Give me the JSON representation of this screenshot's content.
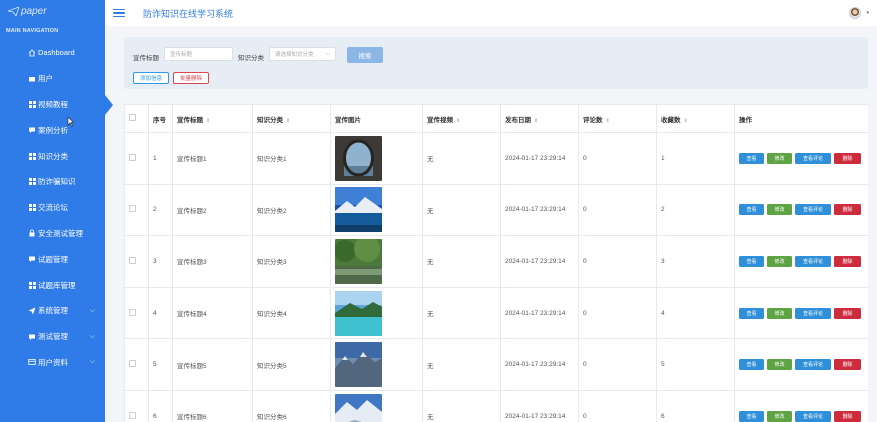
{
  "sidebar": {
    "logo": "paper",
    "nav_header": "MAIN NAVIGATION",
    "items": [
      {
        "label": "Dashboard",
        "icon": "home-icon"
      },
      {
        "label": "用户",
        "icon": "user-icon"
      },
      {
        "label": "视频教程",
        "icon": "grid-icon",
        "active": true
      },
      {
        "label": "案例分析",
        "icon": "comment-icon"
      },
      {
        "label": "知识分类",
        "icon": "grid-icon"
      },
      {
        "label": "防诈骗知识",
        "icon": "grid-icon"
      },
      {
        "label": "交流论坛",
        "icon": "grid-icon"
      },
      {
        "label": "安全测试管理",
        "icon": "lock-icon"
      },
      {
        "label": "试题管理",
        "icon": "comment-icon"
      },
      {
        "label": "试题库管理",
        "icon": "grid-icon"
      },
      {
        "label": "系统管理",
        "icon": "send-icon",
        "expandable": true
      },
      {
        "label": "测试管理",
        "icon": "comment-icon",
        "expandable": true
      },
      {
        "label": "用户资料",
        "icon": "card-icon",
        "expandable": true
      }
    ]
  },
  "header": {
    "title": "防诈知识在线学习系统"
  },
  "filter": {
    "title_label": "宣传标题",
    "title_placeholder": "宣传标题",
    "category_label": "知识分类",
    "category_placeholder": "请选择知识分类",
    "search_label": "搜索",
    "add_label": "添加信息",
    "batch_delete_label": "批量删除"
  },
  "table": {
    "columns": [
      "序号",
      "宣传标题",
      "知识分类",
      "宣传图片",
      "宣传视频",
      "发布日期",
      "评论数",
      "收藏数",
      "操作"
    ],
    "actions": {
      "view": "查看",
      "edit": "修改",
      "comments": "查看评论",
      "delete": "删除"
    },
    "rows": [
      {
        "no": "1",
        "title": "宣传标题1",
        "category": "知识分类1",
        "video": "无",
        "date": "2024-01-17 23:29:14",
        "comments": "0",
        "favorites": "1",
        "image": "stone-arch"
      },
      {
        "no": "2",
        "title": "宣传标题2",
        "category": "知识分类2",
        "video": "无",
        "date": "2024-01-17 23:29:14",
        "comments": "0",
        "favorites": "2",
        "image": "mountain-lake"
      },
      {
        "no": "3",
        "title": "宣传标题3",
        "category": "知识分类3",
        "video": "无",
        "date": "2024-01-17 23:29:14",
        "comments": "0",
        "favorites": "3",
        "image": "pond-trees"
      },
      {
        "no": "4",
        "title": "宣传标题4",
        "category": "知识分类4",
        "video": "无",
        "date": "2024-01-17 23:29:14",
        "comments": "0",
        "favorites": "4",
        "image": "turquoise-lake"
      },
      {
        "no": "5",
        "title": "宣传标题5",
        "category": "知识分类5",
        "video": "无",
        "date": "2024-01-17 23:29:14",
        "comments": "0",
        "favorites": "5",
        "image": "mountain-range"
      },
      {
        "no": "6",
        "title": "宣传标题6",
        "category": "知识分类6",
        "video": "无",
        "date": "2024-01-17 23:29:14",
        "comments": "0",
        "favorites": "6",
        "image": "snowy-peaks"
      }
    ]
  },
  "colors": {
    "sidebar": "#2f7be7",
    "view_button": "#2f8fd8",
    "edit_button": "#5ea344",
    "delete_button": "#cc2c3c"
  }
}
